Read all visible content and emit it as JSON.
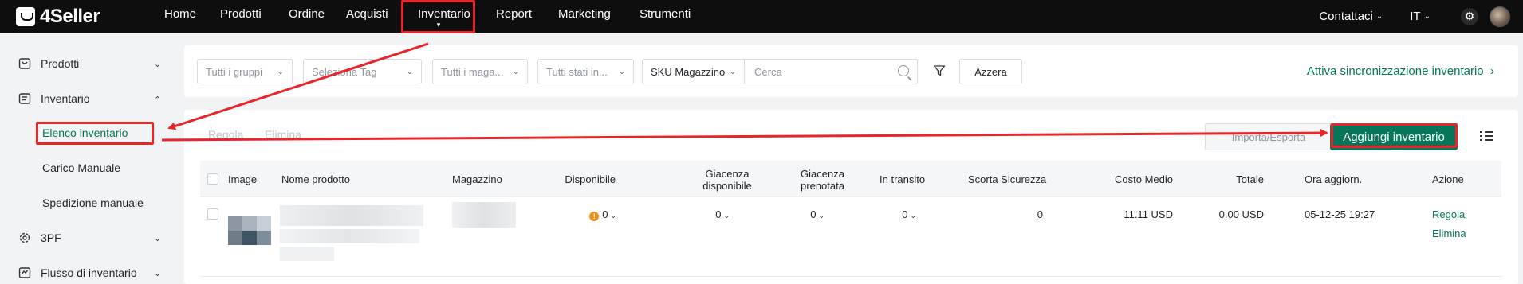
{
  "brand": {
    "name": "4Seller"
  },
  "nav": {
    "items": [
      "Home",
      "Prodotti",
      "Ordine",
      "Acquisti",
      "Inventario",
      "Report",
      "Marketing",
      "Strumenti"
    ],
    "active": "Inventario"
  },
  "top_right": {
    "contacts": "Contattaci",
    "language": "IT"
  },
  "sidebar": {
    "products": "Prodotti",
    "inventory": "Inventario",
    "inventory_list": "Elenco inventario",
    "manual_load": "Carico Manuale",
    "manual_shipping": "Spedizione manuale",
    "threepf": "3PF",
    "inventory_flow": "Flusso di inventario"
  },
  "filters": {
    "groups": "Tutti i gruppi",
    "tag": "Seleziona Tag",
    "warehouses": "Tutti i maga...",
    "states": "Tutti stati in...",
    "sku_select": "SKU Magazzino",
    "search_placeholder": "Cerca",
    "reset": "Azzera",
    "sync_link": "Attiva sincronizzazione inventario"
  },
  "toolbar": {
    "adjust": "Regola",
    "delete": "Elimina",
    "import_export": "Importa/Esporta",
    "add_inventory": "Aggiungi inventario"
  },
  "table": {
    "headers": {
      "image": "Image",
      "name": "Nome prodotto",
      "warehouse": "Magazzino",
      "available": "Disponibile",
      "available_stock_1": "Giacenza",
      "available_stock_2": "disponibile",
      "reserved_stock_1": "Giacenza",
      "reserved_stock_2": "prenotata",
      "in_transit": "In transito",
      "safety_stock": "Scorta Sicurezza",
      "avg_cost": "Costo Medio",
      "total": "Totale",
      "updated": "Ora aggiorn.",
      "action": "Azione"
    },
    "rows": [
      {
        "available": "0",
        "available_stock": "0",
        "reserved_stock": "0",
        "in_transit": "0",
        "safety_stock": "0",
        "avg_cost": "11.11 USD",
        "total": "0.00 USD",
        "updated": "05-12-25 19:27",
        "action_adjust": "Regola",
        "action_delete": "Elimina"
      }
    ]
  },
  "colors": {
    "accent": "#06755a",
    "annotation": "#e8262a",
    "topbar": "#0e0e0e"
  }
}
